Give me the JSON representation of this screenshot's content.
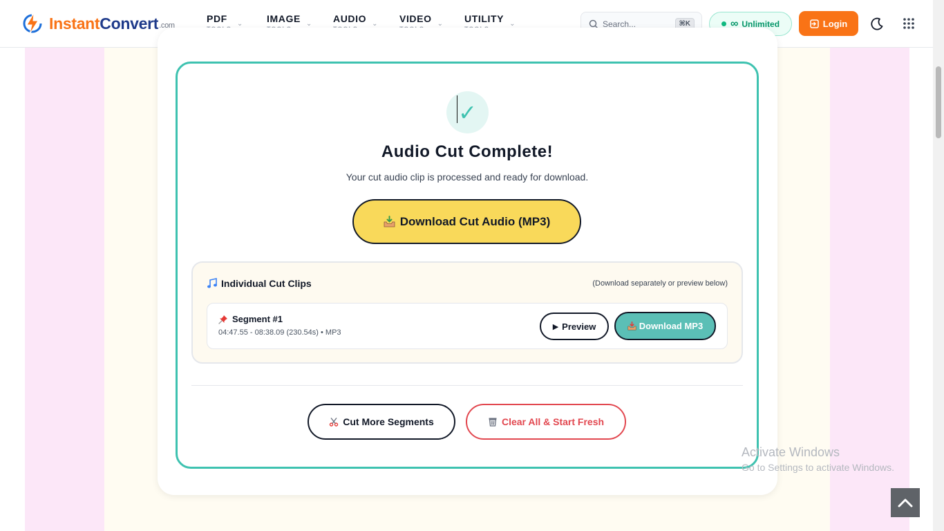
{
  "header": {
    "logo": {
      "primary": "Instant",
      "secondary": "Convert",
      "suffix": ".com"
    },
    "nav": [
      {
        "label": "PDF",
        "sub": "TOOLS"
      },
      {
        "label": "IMAGE",
        "sub": "TOOLS"
      },
      {
        "label": "AUDIO",
        "sub": "TOOLS"
      },
      {
        "label": "VIDEO",
        "sub": "TOOLS"
      },
      {
        "label": "UTILITY",
        "sub": "TOOLS"
      }
    ],
    "search": {
      "placeholder": "Search...",
      "shortcut": "⌘K"
    },
    "plan_badge": "Unlimited",
    "login_label": "Login"
  },
  "result": {
    "title": "Audio Cut Complete!",
    "subtitle": "Your cut audio clip is processed and ready for download.",
    "download_main_label": "Download Cut Audio (MP3)",
    "clips": {
      "title": "Individual Cut Clips",
      "hint": "(Download separately or preview below)",
      "segments": [
        {
          "title": "Segment #1",
          "meta": "04:47.55 - 08:38.09 (230.54s) • MP3",
          "preview_label": "Preview",
          "download_label": "Download MP3"
        }
      ]
    },
    "cut_more_label": "Cut More Segments",
    "clear_all_label": "Clear All & Start Fresh"
  },
  "watermark": {
    "line1": "Activate Windows",
    "line2": "Go to Settings to activate Windows."
  },
  "colors": {
    "accent_teal": "#3ec2b0",
    "brand_orange": "#f97316",
    "brand_navy": "#1e3a8a",
    "download_yellow": "#f9d95a",
    "danger_red": "#e2474f",
    "band_pink": "#fce7f8"
  },
  "icons": {
    "logo": "lightning-bolt-icon",
    "search": "search-icon",
    "plan": "infinity-icon",
    "login": "login-arrow-icon",
    "theme": "moon-icon",
    "apps": "grid-dots-icon",
    "success": "check-icon",
    "download": "inbox-tray-icon",
    "clips": "music-note-icon",
    "segment": "pushpin-icon",
    "preview": "play-icon",
    "cut": "scissors-icon",
    "clear": "wastebasket-icon",
    "top": "chevron-up-icon"
  }
}
